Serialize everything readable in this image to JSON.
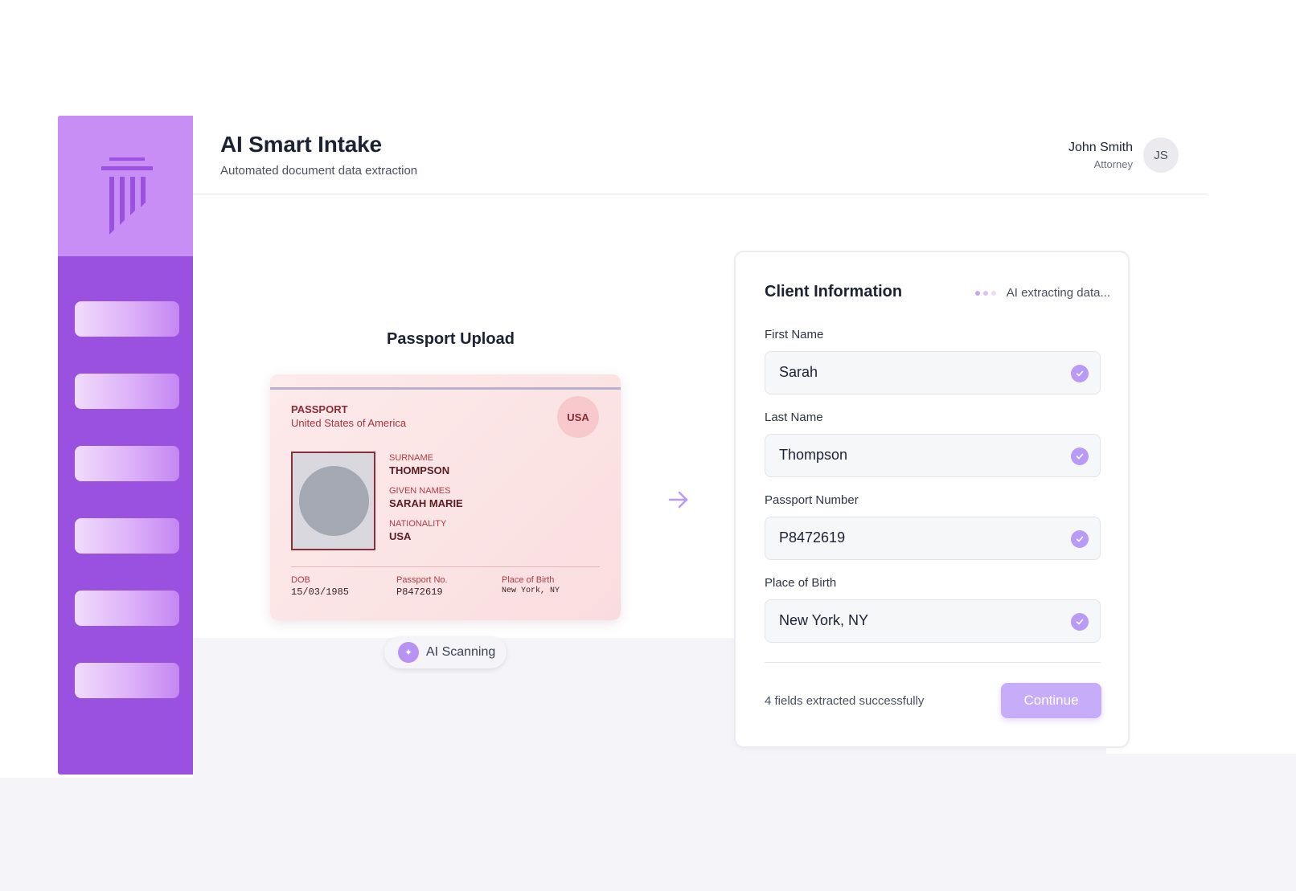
{
  "header": {
    "title": "AI Smart Intake",
    "subtitle": "Automated document data extraction"
  },
  "user": {
    "name": "John Smith",
    "role": "Attorney",
    "initials": "JS"
  },
  "sidebar": {
    "logo_icon": "pillar-logo-icon",
    "nav_item_count": 6
  },
  "upload": {
    "title": "Passport Upload",
    "scan_label": "AI Scanning",
    "scan_icon": "sparkle-icon"
  },
  "passport": {
    "label": "PASSPORT",
    "country": "United States of America",
    "badge": "USA",
    "surname_label": "SURNAME",
    "surname": "THOMPSON",
    "given_names_label": "GIVEN NAMES",
    "given_names": "SARAH MARIE",
    "nationality_label": "NATIONALITY",
    "nationality": "USA",
    "dob_label": "DOB",
    "dob": "15/03/1985",
    "passport_no_label": "Passport No.",
    "passport_no": "P8472619",
    "place_of_birth_label": "Place of Birth",
    "place_of_birth": "New York, NY"
  },
  "client_info": {
    "title": "Client Information",
    "status": "AI extracting data...",
    "fields": [
      {
        "label": "First Name",
        "value": "Sarah"
      },
      {
        "label": "Last Name",
        "value": "Thompson"
      },
      {
        "label": "Passport Number",
        "value": "P8472619"
      },
      {
        "label": "Place of Birth",
        "value": "New York, NY"
      }
    ],
    "footnote": "4 fields extracted successfully",
    "continue_label": "Continue"
  },
  "colors": {
    "sidebar": "#9b51e0",
    "sidebar_top": "#c98ef6",
    "accent": "#b99af6",
    "passport_bg": "#fdeaea",
    "continue_button": "#c7acfa"
  }
}
